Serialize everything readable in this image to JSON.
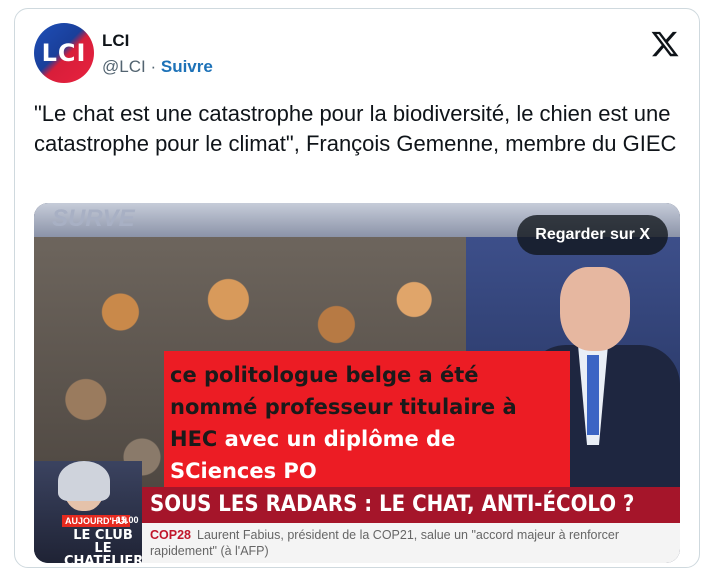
{
  "account": {
    "avatar_text": "LCI",
    "name": "LCI",
    "handle": "@LCI",
    "separator": "·",
    "follow_label": "Suivre"
  },
  "tweet": {
    "text": "\"Le chat est une catastrophe pour la biodiversité, le chien est une catastrophe pour le climat\", François Gemenne, membre du GIEC"
  },
  "media": {
    "watch_label": "Regarder sur X",
    "studio_text": "SURVE",
    "overlay_black_1": "ce politologue belge a été nommé professeur titulaire  à HEC ",
    "overlay_white": "avec un diplôme de SCiences PO",
    "badge_today": "AUJOURD'HUI",
    "badge_time": "15.00",
    "club_line1": "LE CLUB",
    "club_line2": "LE CHATELIER",
    "banner": "SOUS LES RADARS : LE CHAT, ANTI-ÉCOLO ?",
    "ticker_tag": "COP28",
    "ticker_text": "Laurent Fabius, président de la COP21, salue un \"accord majeur à renforcer rapidement\" (à l'AFP)"
  },
  "colors": {
    "follow": "#1d72b8",
    "overlay_red": "#ec1c24",
    "banner_red": "#a5152a"
  }
}
